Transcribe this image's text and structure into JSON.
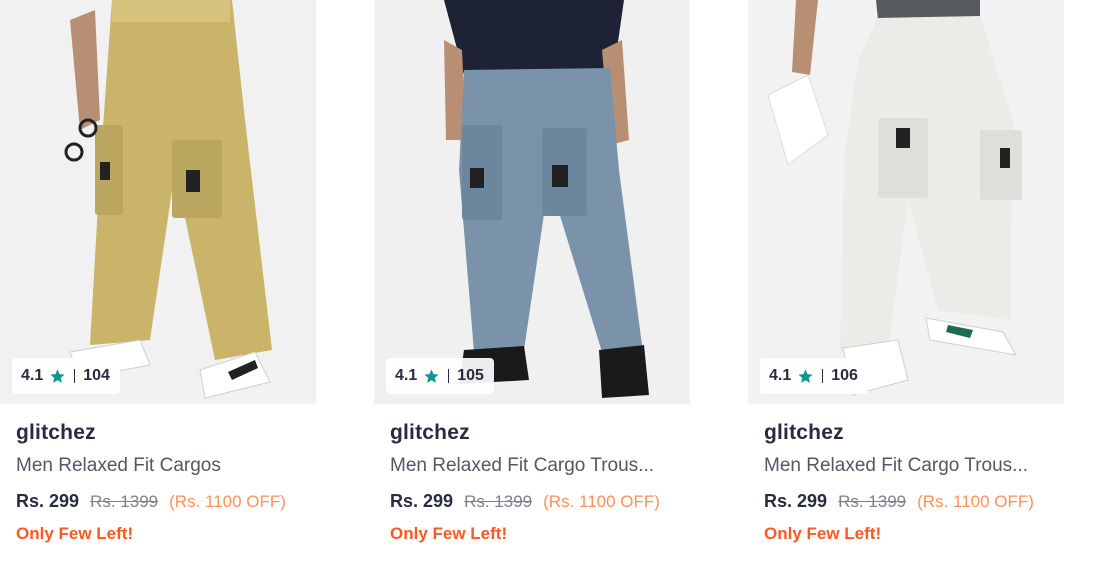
{
  "colors": {
    "star": "#14958f",
    "offer": "#ff905a",
    "stock": "#ff5722"
  },
  "products": [
    {
      "rating": "4.1",
      "rating_count": "104",
      "brand": "glitchez",
      "title": "Men Relaxed Fit Cargos",
      "price": "Rs. 299",
      "mrp": "Rs. 1399",
      "discount": "(Rs. 1100 OFF)",
      "stock": "Only Few Left!",
      "pant_color": "#c9b46a"
    },
    {
      "rating": "4.1",
      "rating_count": "105",
      "brand": "glitchez",
      "title": "Men Relaxed Fit Cargo Trous...",
      "price": "Rs. 299",
      "mrp": "Rs. 1399",
      "discount": "(Rs. 1100 OFF)",
      "stock": "Only Few Left!",
      "pant_color": "#7a93ab"
    },
    {
      "rating": "4.1",
      "rating_count": "106",
      "brand": "glitchez",
      "title": "Men Relaxed Fit Cargo Trous...",
      "price": "Rs. 299",
      "mrp": "Rs. 1399",
      "discount": "(Rs. 1100 OFF)",
      "stock": "Only Few Left!",
      "pant_color": "#ebebe7"
    }
  ]
}
